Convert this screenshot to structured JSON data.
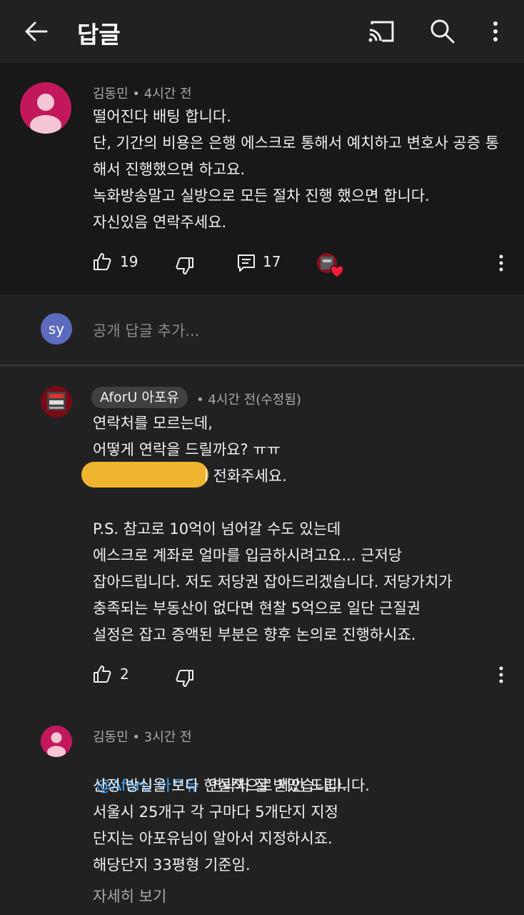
{
  "appbar": {
    "title": "답글",
    "icons": [
      "back-arrow-icon",
      "cast-icon",
      "search-icon",
      "more-vert-icon"
    ]
  },
  "top_comment": {
    "author": "김동민",
    "time": "4시간 전",
    "text": "떨어진다 배팅 합니다.\n단, 기간의 비용은 은행 에스크로 통해서 예치하고 변호사 공증 통해서 진행했으면 하고요.\n녹화방송말고 실방으로 모든 절차 진행 했으면 합니다.\n자신있음 연락주세요.",
    "likes": "19",
    "replies": "17",
    "avatar_color": "#c2185b"
  },
  "add_reply": {
    "avatar_initials": "sy",
    "placeholder": "공개 답글 추가..."
  },
  "reply1": {
    "author": "AforU 아포유",
    "time": "4시간 전(수정됨)",
    "line1": "연락처를 모르는데,",
    "line2": "어떻게 연락을 드릴까요? ㅠㅠ",
    "line3_visible": "l  전화주세요.",
    "ps": "P.S. 참고로 10억이 넘어갈 수도 있는데\n에스크로 계좌로 얼마를 입금하시려고요... 근저당\n잡아드립니다. 저도 저당권 잡아드리겠습니다. 저당가치가\n충족되는 부동산이 없다면 현찰 5억으로 일단 근질권\n설정은 잡고 증액된 부분은 향후 논의로 진행하시죠.",
    "likes": "2",
    "avatar_text": "AFORU"
  },
  "reply2": {
    "author": "김동민",
    "time": "3시간 전",
    "mention": "@AforU 아포유",
    "line1_rest": "연락처 잘 받았습니다.",
    "rest": "산정 방실을 보다 현실적으로 제안 드립니다.\n서울시 25개구 각 구마다 5개단지 지정\n단지는 아포유님이 알아서 지정하시죠.\n해당단지 33평형 기준임.",
    "more": "자세히 보기"
  },
  "colors": {
    "background": "#212121",
    "highlight_background": "#181818",
    "mention": "#3ea6ff",
    "redaction": "#f0b52e",
    "heart": "#ff1a3c"
  }
}
